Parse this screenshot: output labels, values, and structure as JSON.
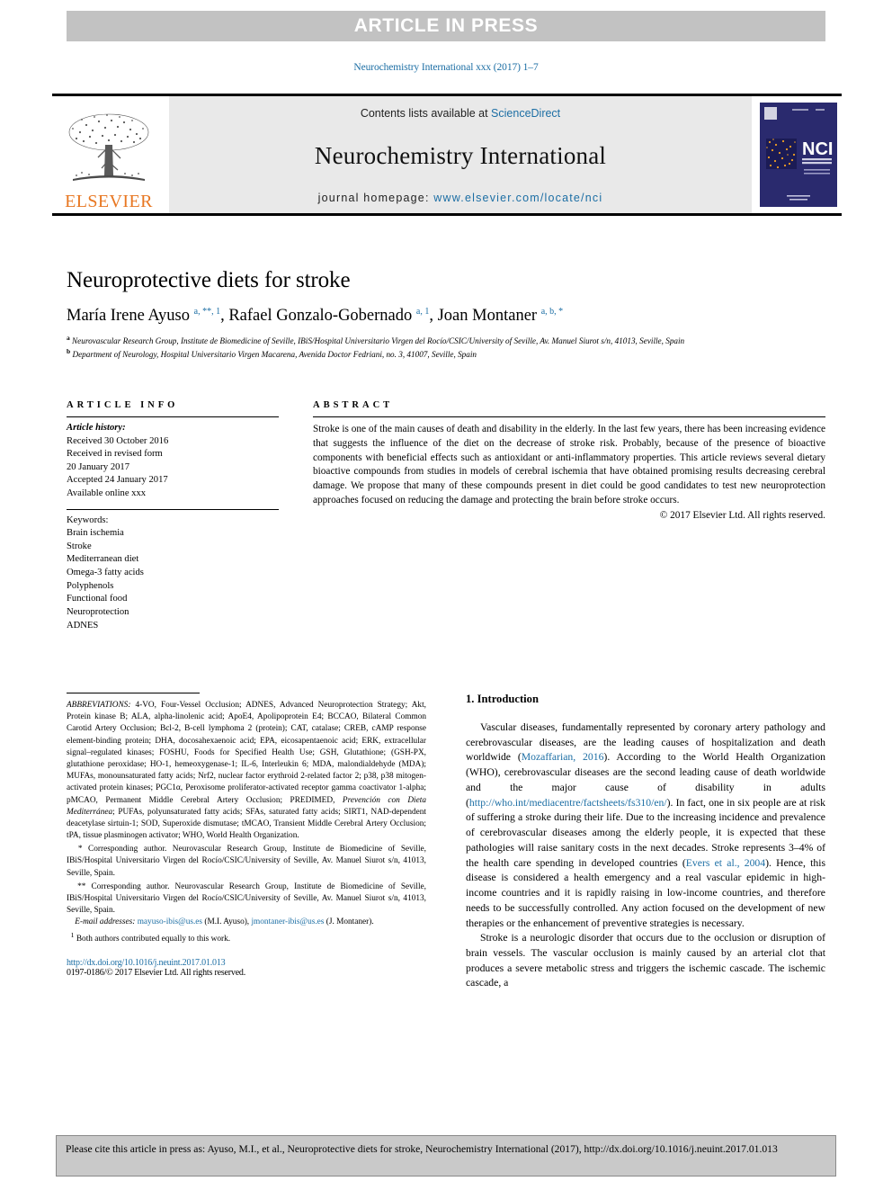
{
  "banner": {
    "text": "ARTICLE IN PRESS"
  },
  "journal_ref": "Neurochemistry International xxx (2017) 1–7",
  "masthead": {
    "contents_prefix": "Contents lists available at ",
    "contents_link": "ScienceDirect",
    "journal_title": "Neurochemistry International",
    "homepage_prefix": "journal homepage: ",
    "homepage_url": "www.elsevier.com/locate/nci",
    "publisher": "ELSEVIER",
    "cover_code": "NCI",
    "cover_sub": "NEUROCHEMISTRY INTERNATIONAL"
  },
  "article": {
    "title": "Neuroprotective diets for stroke",
    "authors_html": "María Irene Ayuso <sup>a, **, 1</sup>, Rafael Gonzalo-Gobernado <sup>a, 1</sup>, Joan Montaner <sup>a, b, *</sup>",
    "affiliation_a": "Neurovascular Research Group, Institute de Biomedicine of Seville, IBiS/Hospital Universitario Virgen del Rocío/CSIC/University of Seville, Av. Manuel Siurot s/n, 41013, Seville, Spain",
    "affiliation_b": "Department of Neurology, Hospital Universitario Virgen Macarena, Avenida Doctor Fedriani, no. 3, 41007, Seville, Spain"
  },
  "info": {
    "heading": "ARTICLE INFO",
    "history_label": "Article history:",
    "history": [
      "Received 30 October 2016",
      "Received in revised form",
      "20 January 2017",
      "Accepted 24 January 2017",
      "Available online xxx"
    ],
    "keywords_label": "Keywords:",
    "keywords": [
      "Brain ischemia",
      "Stroke",
      "Mediterranean diet",
      "Omega-3 fatty acids",
      "Polyphenols",
      "Functional food",
      "Neuroprotection",
      "ADNES"
    ]
  },
  "abstract": {
    "heading": "ABSTRACT",
    "text": "Stroke is one of the main causes of death and disability in the elderly. In the last few years, there has been increasing evidence that suggests the influence of the diet on the decrease of stroke risk. Probably, because of the presence of bioactive components with beneficial effects such as antioxidant or anti-inflammatory properties. This article reviews several dietary bioactive compounds from studies in models of cerebral ischemia that have obtained promising results decreasing cerebral damage. We propose that many of these compounds present in diet could be good candidates to test new neuroprotection approaches focused on reducing the damage and protecting the brain before stroke occurs.",
    "copyright": "© 2017 Elsevier Ltd. All rights reserved."
  },
  "footnotes": {
    "abbrev_label": "ABBREVIATIONS:",
    "abbrev_text": " 4-VO, Four-Vessel Occlusion; ADNES, Advanced Neuroprotection Strategy; Akt, Protein kinase B; ALA, alpha-linolenic acid; ApoE4, Apolipoprotein E4; BCCAO, Bilateral Common Carotid Artery Occlusion; Bcl-2, B-cell lymphoma 2 (protein); CAT, catalase; CREB, cAMP response element-binding protein; DHA, docosahexaenoic acid; EPA, eicosapentaenoic acid; ERK, extracellular signal–regulated kinases; FOSHU, Foods for Specified Health Use; GSH, Glutathione; (GSH-PX, glutathione peroxidase; HO-1, hemeoxygenase-1; IL-6, Interleukin 6; MDA, malondialdehyde (MDA); MUFAs, monounsaturated fatty acids; Nrf2, nuclear factor erythroid 2-related factor 2; p38, p38 mitogen-activated protein kinases; PGC1α, Peroxisome proliferator-activated receptor gamma coactivator 1-alpha; pMCAO, Permanent Middle Cerebral Artery Occlusion; PREDIMED, ",
    "abbrev_italic": "Prevención con Dieta Mediterránea",
    "abbrev_text2": "; PUFAs, polyunsaturated fatty acids; SFAs, saturated fatty acids; SIRT1, NAD-dependent deacetylase sirtuin-1; SOD, Superoxide dismutase; tMCAO, Transient Middle Cerebral Artery Occlusion; tPA, tissue plasminogen activator; WHO, World Health Organization.",
    "corresp1": "* Corresponding author. Neurovascular Research Group, Institute de Biomedicine of Seville, IBiS/Hospital Universitario Virgen del Rocío/CSIC/University of Seville, Av. Manuel Siurot s/n, 41013, Seville, Spain.",
    "corresp2": "** Corresponding author. Neurovascular Research Group, Institute de Biomedicine of Seville, IBiS/Hospital Universitario Virgen del Rocío/CSIC/University of Seville, Av. Manuel Siurot s/n, 41013, Seville, Spain.",
    "emails_label": "E-mail addresses:",
    "email1": "mayuso-ibis@us.es",
    "email1_who": "(M.I. Ayuso),",
    "email2": "jmontaner-ibis@us.es",
    "email2_who": "(J. Montaner).",
    "equal_marker": "1",
    "equal_text": "Both authors contributed equally to this work.",
    "doi": "http://dx.doi.org/10.1016/j.neuint.2017.01.013",
    "issn": "0197-0186/© 2017 Elsevier Ltd. All rights reserved."
  },
  "introduction": {
    "heading": "1. Introduction",
    "paragraphs": [
      {
        "parts": [
          {
            "t": "Vascular diseases, fundamentally represented by coronary artery pathology and cerebrovascular diseases, are the leading causes of hospitalization and death worldwide ("
          },
          {
            "t": "Mozaffarian, 2016",
            "link": true
          },
          {
            "t": "). According to the World Health Organization (WHO), cerebrovascular diseases are the second leading cause of death worldwide and the major cause of disability in adults ("
          },
          {
            "t": "http://who.int/mediacentre/factsheets/fs310/en/",
            "link": true
          },
          {
            "t": "). In fact, one in six people are at risk of suffering a stroke during their life. Due to the increasing incidence and prevalence of cerebrovascular diseases among the elderly people, it is expected that these pathologies will raise sanitary costs in the next decades. Stroke represents 3–4% of the health care spending in developed countries ("
          },
          {
            "t": "Evers et al., 2004",
            "link": true
          },
          {
            "t": "). Hence, this disease is considered a health emergency and a real vascular epidemic in high-income countries and it is rapidly raising in low-income countries, and therefore needs to be successfully controlled. Any action focused on the development of new therapies or the enhancement of preventive strategies is necessary."
          }
        ]
      },
      {
        "parts": [
          {
            "t": "Stroke is a neurologic disorder that occurs due to the occlusion or disruption of brain vessels. The vascular occlusion is mainly caused by an arterial clot that produces a severe metabolic stress and triggers the ischemic cascade. The ischemic cascade, a"
          }
        ]
      }
    ]
  },
  "citation_footer": {
    "text": "Please cite this article in press as: Ayuso, M.I., et al., Neuroprotective diets for stroke, Neurochemistry International (2017), http://dx.doi.org/10.1016/j.neuint.2017.01.013"
  },
  "colors": {
    "link": "#1c6ea4",
    "elsevier_orange": "#e87722",
    "banner_gray": "#c2c2c2",
    "masthead_gray": "#e9e9e9",
    "footer_gray": "#c9c9c9",
    "cover_navy": "#2a2a6e"
  }
}
